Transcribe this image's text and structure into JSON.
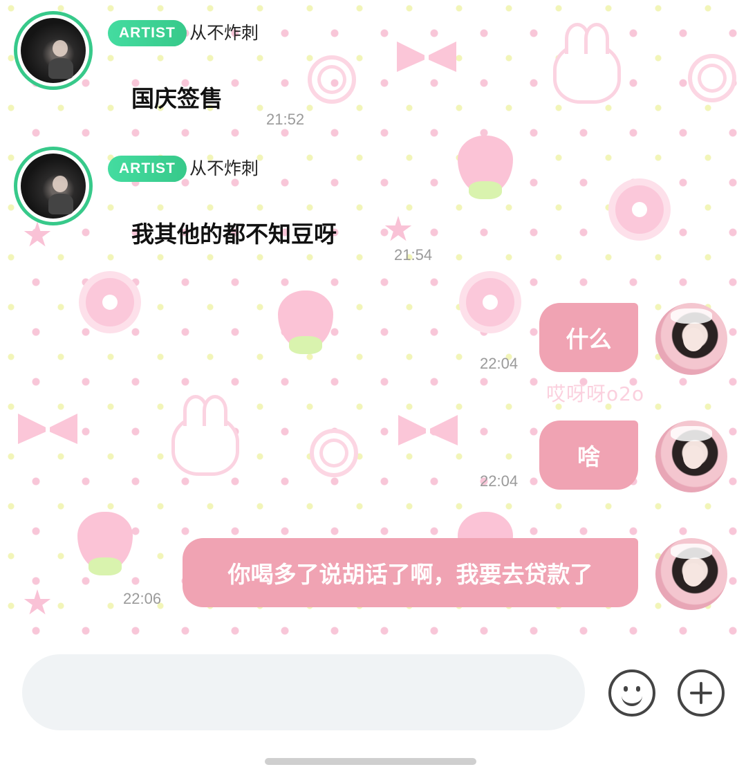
{
  "messages": [
    {
      "side": "left",
      "badge": "ARTIST",
      "sender": "从不炸刺",
      "text": "国庆签售",
      "time": "21:52"
    },
    {
      "side": "left",
      "badge": "ARTIST",
      "sender": "从不炸刺",
      "text": "我其他的都不知豆呀",
      "time": "21:54"
    },
    {
      "side": "right",
      "text": "什么",
      "time": "22:04"
    },
    {
      "side": "right",
      "text": "啥",
      "time": "22:04"
    },
    {
      "side": "right",
      "text": "你喝多了说胡话了啊，我要去贷款了",
      "time": "22:06"
    }
  ],
  "wallpaper_watermark": "哎呀呀o2o",
  "composer": {
    "placeholder": "",
    "emoji_icon": "smiley-icon",
    "plus_icon": "plus-icon"
  },
  "colors": {
    "artist_badge": "#37c98a",
    "my_bubble": "#f0a3b3",
    "timestamp": "#9a9a9a"
  }
}
